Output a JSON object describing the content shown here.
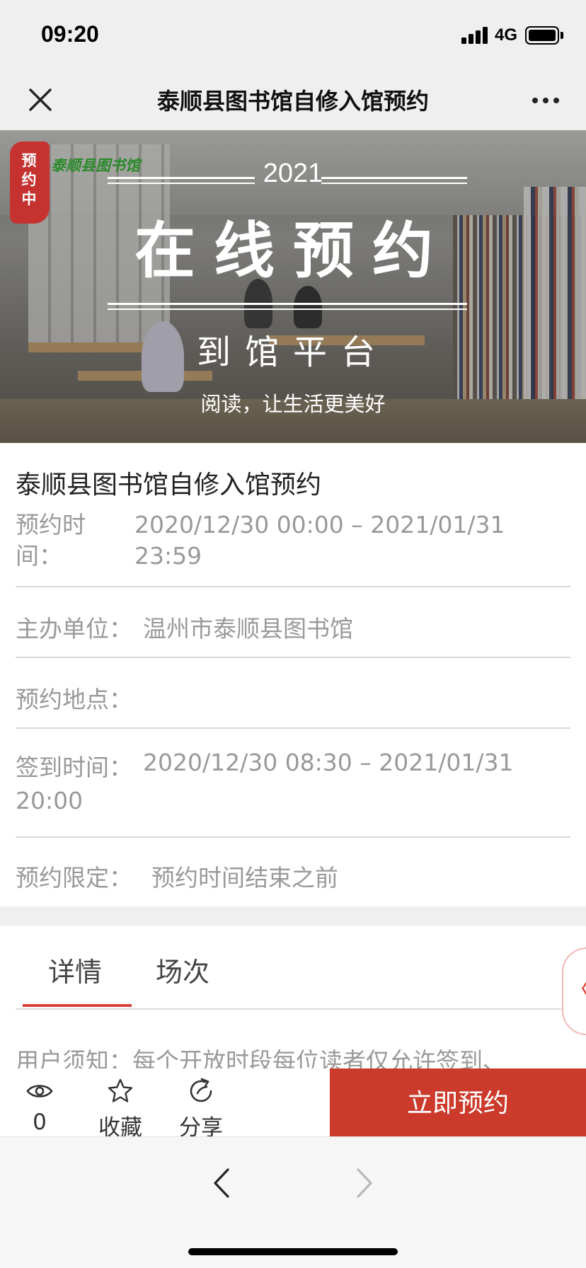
{
  "status_bar": {
    "time": "09:20",
    "network": "4G"
  },
  "nav": {
    "title": "泰顺县图书馆自修入馆预约",
    "close_icon": "close-icon",
    "more_icon": "more-icon"
  },
  "banner": {
    "badge": "预约中",
    "logo_text": "泰顺县图书馆",
    "year": "2021",
    "headline": "在线预约",
    "subheadline": "到馆平台",
    "slogan": "阅读，让生活更美好"
  },
  "info": {
    "title": "泰顺县图书馆自修入馆预约",
    "reserve_time_label": "预约时间：",
    "reserve_time_value_1": "2020/12/30 00:00 – 2021/01/31",
    "reserve_time_value_2": "23:59",
    "organizer_label": "主办单位：",
    "organizer_value": "温州市泰顺县图书馆",
    "location_label": "预约地点：",
    "checkin_label": "签到时间：",
    "checkin_value_1": "2020/12/30 08:30 – 2021/01/31",
    "checkin_value_2": "20:00",
    "limit_label": "预约限定：",
    "limit_value": "预约时间结束之前"
  },
  "tabs": {
    "items": [
      {
        "label": "详情"
      },
      {
        "label": "场次"
      }
    ],
    "active": "详情",
    "notice": "用户须知：每个开放时段每位读者仅允许签到、"
  },
  "actions": {
    "views_count": "0",
    "favorite_label": "收藏",
    "share_label": "分享",
    "reserve_label": "立即预约"
  },
  "colors": {
    "accent": "#cc3a2c",
    "tab_underline": "#d9403a",
    "muted_text": "#999999"
  }
}
